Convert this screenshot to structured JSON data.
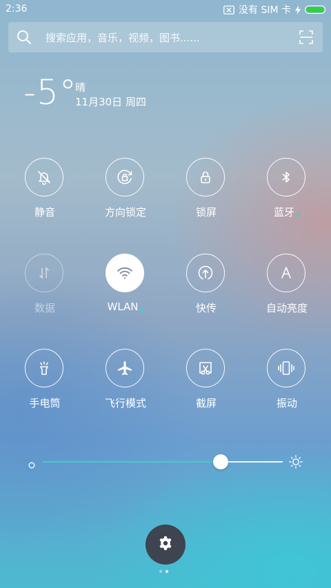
{
  "status_bar": {
    "time": "2:36",
    "sim_status": "没有 SIM 卡",
    "battery_level": 1.0,
    "charging": true
  },
  "search": {
    "placeholder": "搜索应用，音乐，视频，图书......"
  },
  "weather": {
    "temperature": "-5°",
    "condition": "晴",
    "date": "11月30日 周四"
  },
  "toggles": [
    {
      "label": "静音",
      "icon": "bell-off-icon",
      "state": "off"
    },
    {
      "label": "方向锁定",
      "icon": "rotation-lock-icon",
      "state": "off"
    },
    {
      "label": "锁屏",
      "icon": "lock-icon",
      "state": "off"
    },
    {
      "label": "蓝牙",
      "icon": "bluetooth-icon",
      "state": "off",
      "has_submenu": true
    },
    {
      "label": "数据",
      "icon": "data-arrows-icon",
      "state": "disabled"
    },
    {
      "label": "WLAN",
      "icon": "wifi-icon",
      "state": "on",
      "has_submenu": true
    },
    {
      "label": "快传",
      "icon": "quick-transfer-icon",
      "state": "off"
    },
    {
      "label": "自动亮度",
      "icon": "auto-brightness-icon",
      "state": "off"
    },
    {
      "label": "手电筒",
      "icon": "flashlight-icon",
      "state": "off"
    },
    {
      "label": "飞行模式",
      "icon": "airplane-icon",
      "state": "off"
    },
    {
      "label": "截屏",
      "icon": "screenshot-icon",
      "state": "off"
    },
    {
      "label": "振动",
      "icon": "vibrate-icon",
      "state": "off"
    }
  ],
  "brightness": {
    "level": 0.74
  },
  "pagination": {
    "count": 2,
    "active_index": 1
  },
  "colors": {
    "accent": "#3fcfc5",
    "battery": "#2fd43a",
    "settings_button": "#3e4450"
  }
}
